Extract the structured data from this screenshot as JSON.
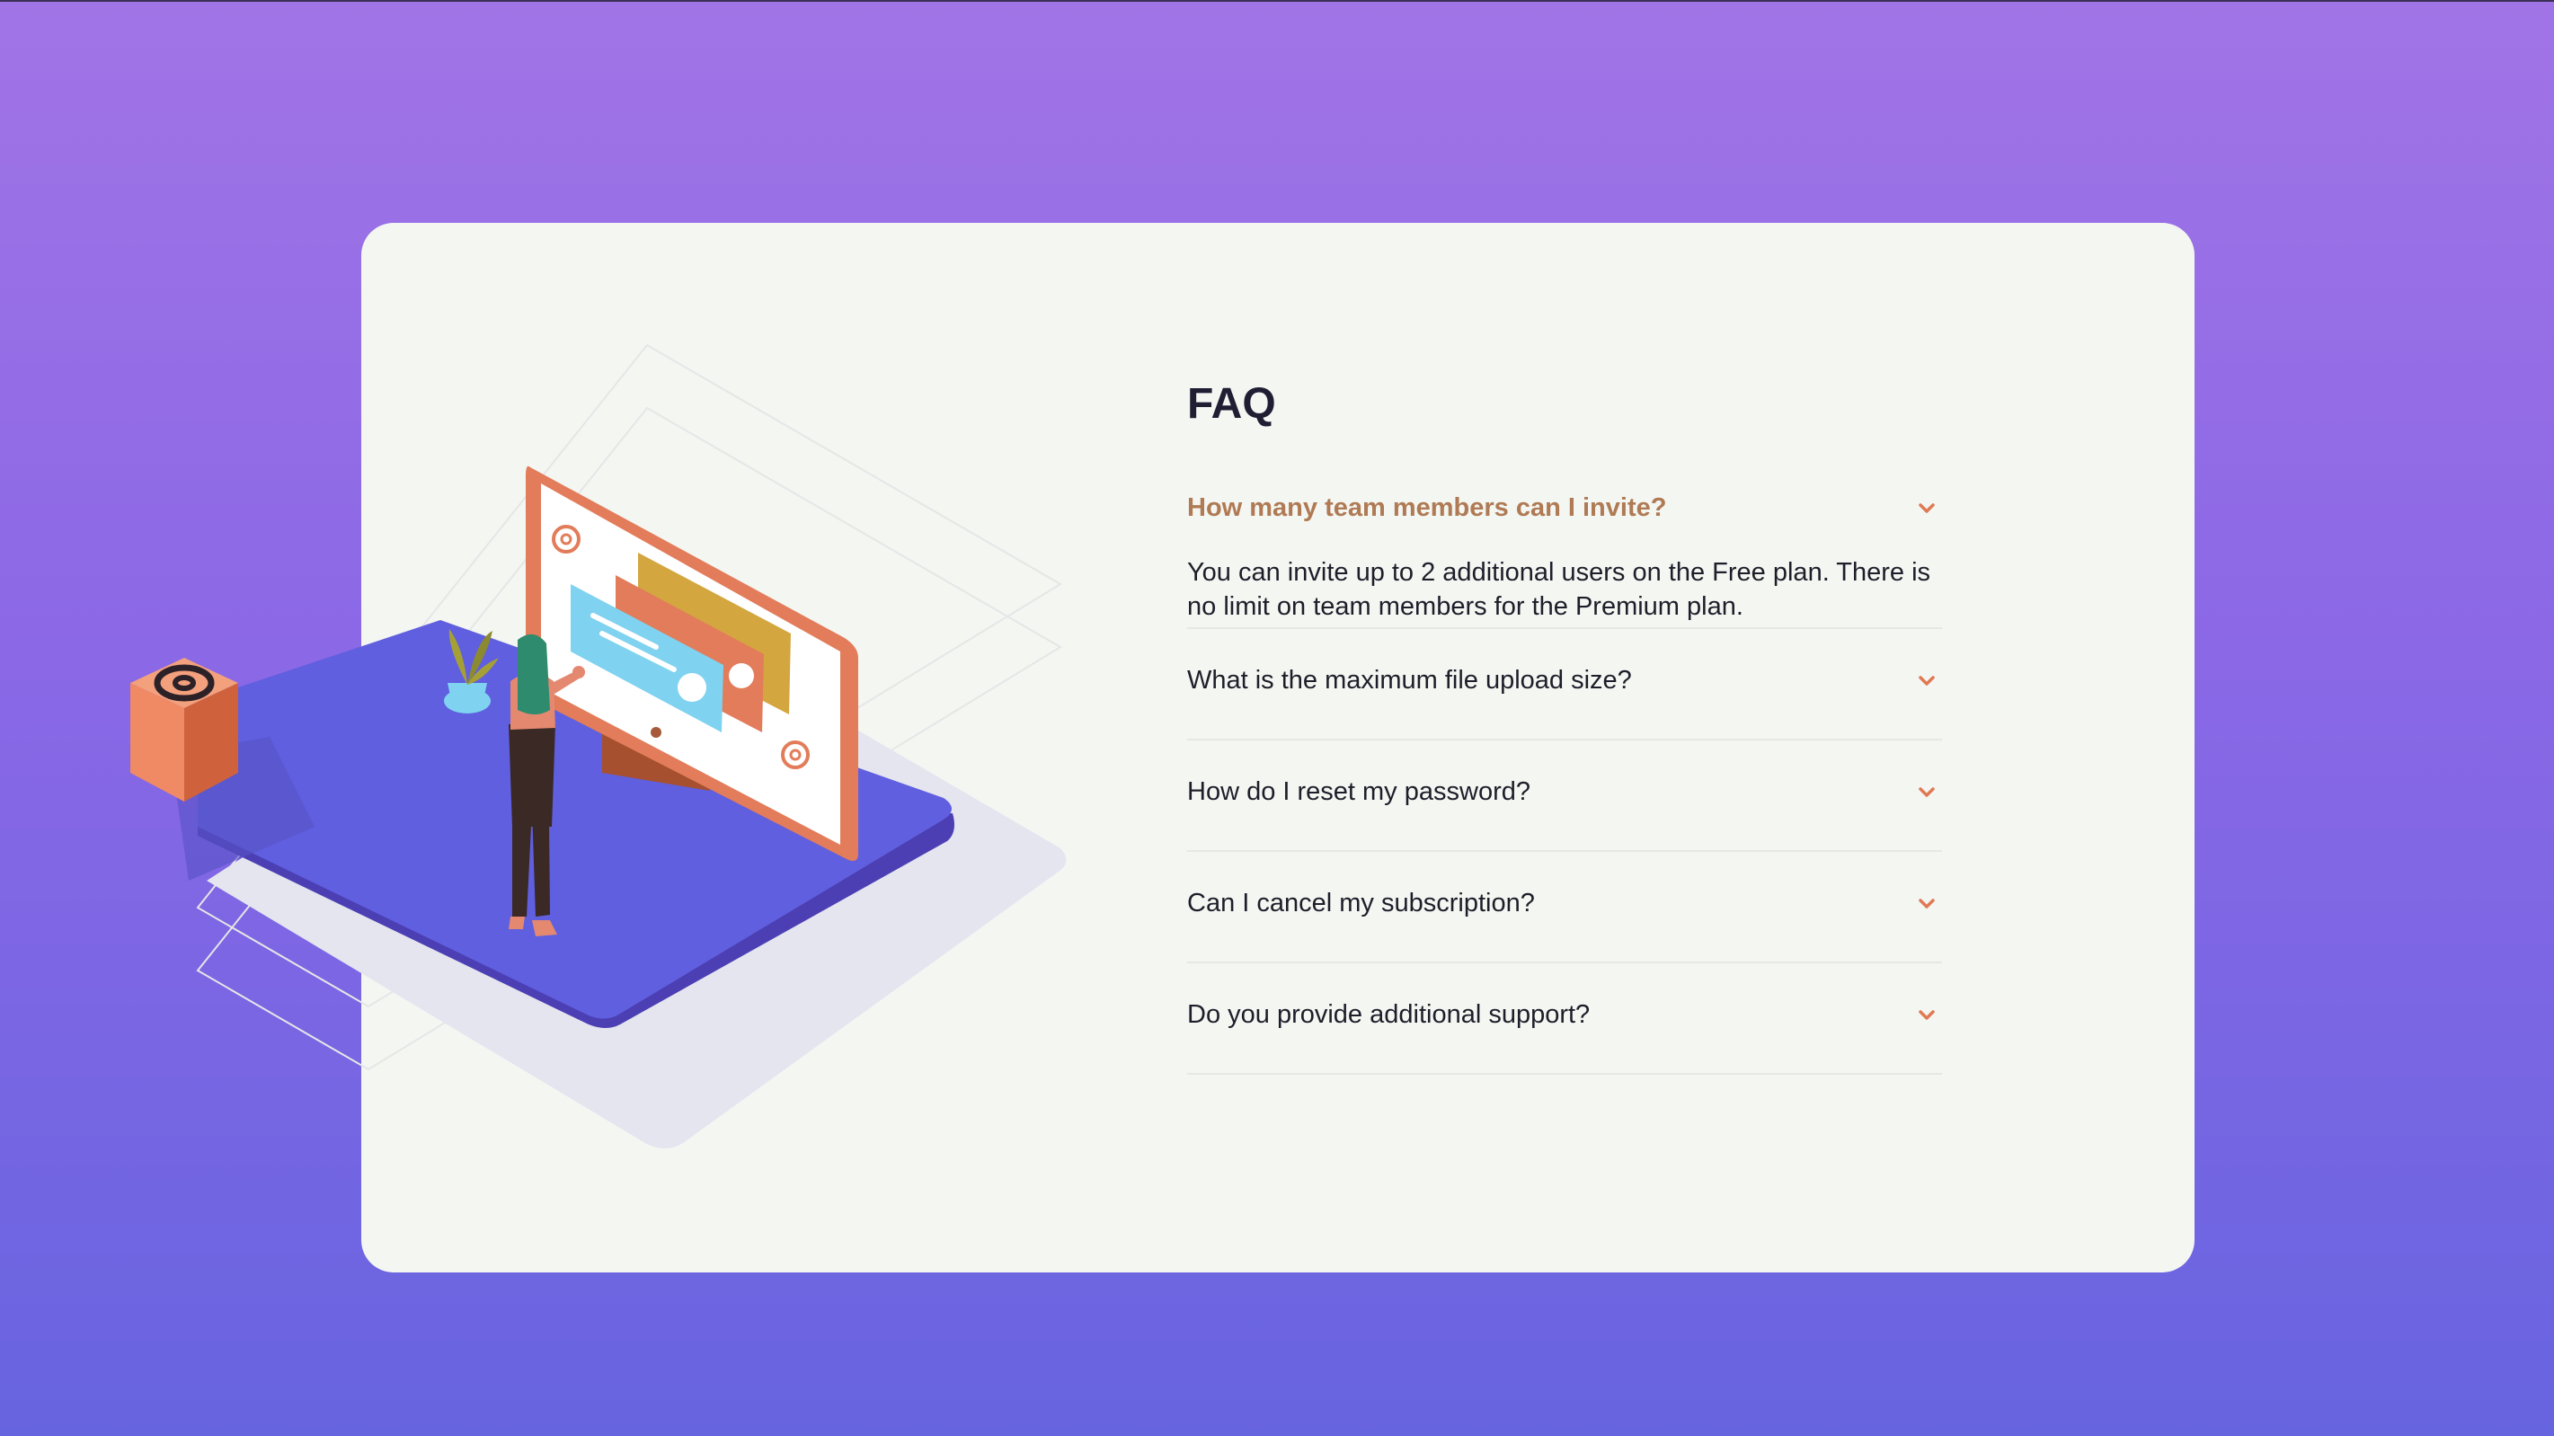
{
  "faq": {
    "title": "FAQ",
    "items": [
      {
        "question": "How many team members can I invite?",
        "answer": "You can invite up to 2 additional users on the Free plan. There is no limit on team members for the Premium plan.",
        "open": true
      },
      {
        "question": "What is the maximum file upload size?",
        "open": false
      },
      {
        "question": "How do I reset my password?",
        "open": false
      },
      {
        "question": "Can I cancel my subscription?",
        "open": false
      },
      {
        "question": "Do you provide additional support?",
        "open": false
      }
    ]
  },
  "icons": {
    "chevron": "chevron-down-icon",
    "at_sign": "at-sign-icon"
  },
  "colors": {
    "background_top": "#a174e6",
    "background_bottom": "#6764e0",
    "card": "#f4f6f2",
    "open_question": "#af7a54",
    "chevron": "#e07a55",
    "platform": "#5f5fdf",
    "cube": "#f08a64",
    "monitor_frame": "#e27c5a"
  }
}
